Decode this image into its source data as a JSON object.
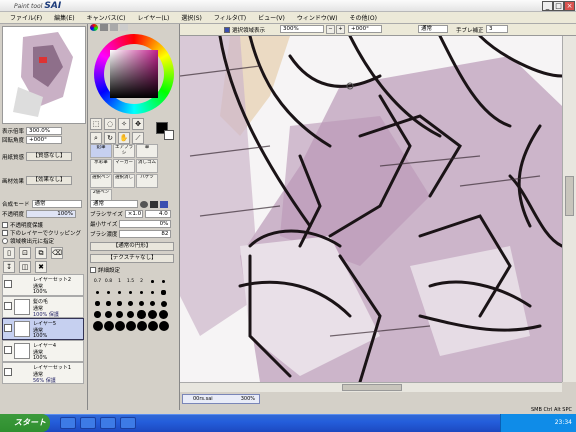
{
  "window": {
    "brand_prefix": "Paint tool",
    "brand": "SAI",
    "minimize": "_",
    "maximize": "□",
    "close": "×"
  },
  "menu": [
    "ファイル(F)",
    "編集(E)",
    "キャンバス(C)",
    "レイヤー(L)",
    "選択(S)",
    "フィルタ(T)",
    "ビュー(V)",
    "ウィンドウ(W)",
    "その他(O)"
  ],
  "navigator": {
    "zoom_label": "表示倍率",
    "zoom": "300.0%",
    "rotate_label": "回転角度",
    "rotate": "+000°"
  },
  "layer_panel": {
    "paper_label": "用紙質感",
    "paper": "【質感なし】",
    "effect_label": "画材効果",
    "effect": "【効果なし】",
    "blend_label": "合成モード",
    "blend": "通常",
    "opacity_label": "不透明度",
    "opacity": "100%",
    "opt1": "不透明度保護",
    "opt2": "下のレイヤーでクリッピング",
    "opt3": "領域検出元に指定"
  },
  "layers": [
    {
      "name": "レイヤーセット2",
      "mode": "通常",
      "opacity": "100%"
    },
    {
      "name": "髪の毛",
      "mode": "通常",
      "opacity": "100% 保護"
    },
    {
      "name": "レイヤー5",
      "mode": "通常",
      "opacity": "100%"
    },
    {
      "name": "レイヤー4",
      "mode": "通常",
      "opacity": "100%"
    },
    {
      "name": "レイヤーセット1",
      "mode": "通常",
      "opacity": "56% 保護"
    }
  ],
  "tools": {
    "cells": [
      "鉛筆",
      "エアブラシ",
      "筆",
      "水彩筆",
      "マーカー",
      "消しゴム",
      "選択ペン",
      "選択消し",
      "バケツ",
      "2値ペン"
    ],
    "mode": "通常",
    "size_label": "ブラシサイズ",
    "size_mult": "×1.0",
    "size": "4.0",
    "min_label": "最小サイズ",
    "min": "0%",
    "density_label": "ブラシ濃度",
    "density": "82",
    "shape": "【通常の円形】",
    "texture": "【テクスチャなし】",
    "detail": "詳細設定",
    "sizes": [
      "0.7",
      "0.8",
      "1",
      "1.5",
      "2",
      "2.3",
      "2.6",
      "3",
      "3.5",
      "4",
      "5",
      "6",
      "7",
      "8",
      "9",
      "10",
      "12",
      "14",
      "16",
      "20",
      "25",
      "30",
      "35",
      "40",
      "50",
      "60",
      "70",
      "80",
      "100",
      "120",
      "160",
      "200",
      "250",
      "300",
      "350"
    ]
  },
  "canvas_toolbar": {
    "show_selection": "選択領域表示",
    "zoom": "300%",
    "rotate": "+000°",
    "blend": "通常",
    "stabilizer_label": "手ブレ補正",
    "stabilizer": "3"
  },
  "doc": {
    "name": "00rs.sai",
    "zoom": "300%"
  },
  "taskbar": {
    "start": "スタート",
    "time": "23:34",
    "status": "SMB Ctrl Alt SPC"
  }
}
